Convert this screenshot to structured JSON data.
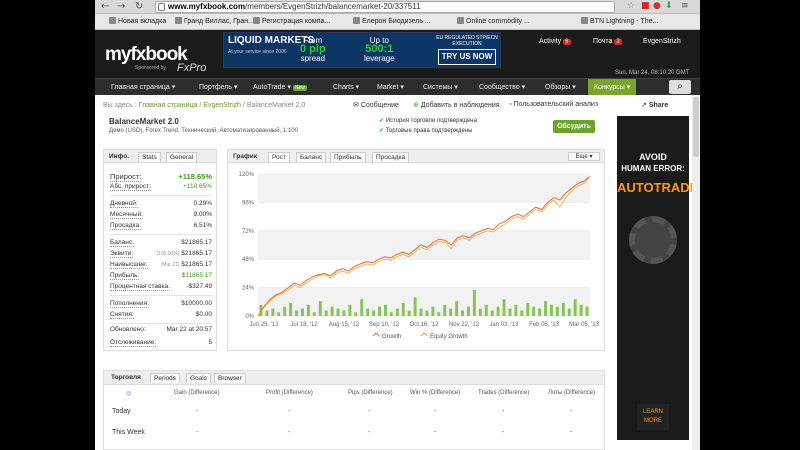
{
  "browser": {
    "url_domain": "www.myfxbook.com",
    "url_path": "/members/EvgenStrizh/balancemarket-20/337511",
    "bookmarks": [
      "Новая вкладка",
      "Гранд Виллас, Гран...",
      "Регистрация компа...",
      "Елерон Биодизель ...",
      "Online commodity ...",
      "BTN Lightning - The..."
    ]
  },
  "header": {
    "logo": "myfxbook",
    "sponsored": "Sponsored by",
    "sponsor_name": "FxPro",
    "banner": {
      "brand": "LIQUID MARKETS",
      "brand_sub": "At your service since 2006",
      "from_label": "From",
      "from_value": "0 pip",
      "from_sub": "spread",
      "upto_label": "Up to",
      "upto_value": "500:1",
      "upto_sub": "leverage",
      "reg": "EU REGULATED STP/ECN EXECUTION",
      "cta": "TRY US NOW"
    },
    "activity_label": "Activity",
    "activity_count": "6",
    "mail_label": "Почта",
    "mail_count": "2",
    "user": "EvgenStrizh",
    "datetime": "Sun, Mar 24, 08:10:20 GMT"
  },
  "menu": {
    "items": [
      "Главная страница ▾",
      "Портфель ▾",
      "AutoTrade ▾",
      "Charts ▾",
      "Market ▾",
      "Системы ▾",
      "Сообщество ▾",
      "Обзоры ▾",
      "Конкурсы ▾"
    ],
    "new_tag": "New"
  },
  "breadcrumb": {
    "prefix": "Вы здесь :",
    "home": "Главная страница",
    "user": "EvgenStrizh",
    "current": "/ BalanceMarket 2.0"
  },
  "actions": {
    "message": "Сообщение",
    "watch": "Добавить в наблюдения",
    "analysis": "Пользовательский анализ",
    "share": "Share"
  },
  "account": {
    "name": "BalanceMarket 2.0",
    "desc": "Демо (USD), Forex Trend, Технический, Автоматизированный, 1:100",
    "verif1": "История торговли подтверждена",
    "verif2": "Торговые права подтверждены",
    "discuss": "Обсудить"
  },
  "info_panel": {
    "tabs": [
      "Инфо.",
      "Stats",
      "General"
    ],
    "gain_label": "Прирост:",
    "gain": "+118.65%",
    "abs_label": "Абс. прирост:",
    "abs": "+118.65%",
    "daily_label": "Дневной:",
    "daily": "0.29%",
    "monthly_label": "Месячный:",
    "monthly": "9.00%",
    "dd_label": "Просадка:",
    "dd": "6.51%",
    "balance_label": "Баланс:",
    "balance": "$21865.17",
    "equity_label": "Эквити:",
    "equity_note": "(100.00%)",
    "equity": "$21865.17",
    "highest_label": "Наивысшее:",
    "highest_note": "(Mar 21)",
    "highest": "$21865.17",
    "profit_label": "Прибыль:",
    "profit": "$11865.17",
    "interest_label": "Процентная ставка:",
    "interest": "-$327.49",
    "deposits_label": "Пополнения:",
    "deposits": "$10000.00",
    "withdrawals_label": "Снятия:",
    "withdrawals": "$0.00",
    "updated_label": "Обновлено:",
    "updated": "Mar 22 at 20:57",
    "tracking_label": "Отслеживание:",
    "tracking": "5"
  },
  "chart_panel": {
    "tabs": [
      "График",
      "Рост",
      "Баланс",
      "Прибыль",
      "Просадка"
    ],
    "more": "Еще"
  },
  "chart_data": {
    "type": "line",
    "x_ticks": [
      "Jun 25, '12",
      "Jul 18, '12",
      "Aug 15, '12",
      "Sep 10, '12",
      "Oct 16, '12",
      "Nov 22, '12",
      "Jan 03, '13",
      "Feb 06, '13",
      "Mar 05, '13"
    ],
    "y_ticks": [
      "0%",
      "24%",
      "48%",
      "72%",
      "96%",
      "120%"
    ],
    "ylim": [
      0,
      120
    ],
    "series": [
      {
        "name": "Growth",
        "color": "#e8683a",
        "values": [
          0,
          8,
          14,
          18,
          20,
          24,
          28,
          26,
          30,
          33,
          35,
          36,
          34,
          38,
          40,
          38,
          42,
          44,
          46,
          45,
          48,
          50,
          49,
          52,
          54,
          52,
          56,
          60,
          58,
          62,
          65,
          64,
          60,
          66,
          68,
          66,
          70,
          72,
          74,
          73,
          78,
          80,
          84,
          86,
          84,
          88,
          92,
          90,
          96,
          100,
          98,
          104,
          108,
          112,
          114,
          118
        ]
      },
      {
        "name": "Equity Growth",
        "color": "#e8a830",
        "values": [
          0,
          7,
          13,
          17,
          19,
          22,
          26,
          24,
          28,
          31,
          34,
          35,
          32,
          36,
          38,
          36,
          40,
          42,
          44,
          43,
          46,
          48,
          47,
          50,
          52,
          50,
          54,
          58,
          56,
          60,
          63,
          62,
          57,
          64,
          66,
          64,
          68,
          70,
          72,
          71,
          75,
          78,
          82,
          84,
          82,
          86,
          90,
          88,
          94,
          98,
          92,
          100,
          106,
          110,
          112,
          118
        ]
      }
    ],
    "bars": [
      6,
      3,
      4,
      2,
      5,
      7,
      3,
      4,
      6,
      2,
      8,
      3,
      5,
      4,
      3,
      6,
      2,
      9,
      4,
      3,
      5,
      6,
      2,
      4,
      7,
      3,
      10,
      4,
      3,
      5,
      2,
      6,
      4,
      8,
      3,
      5,
      14,
      4,
      6,
      3,
      5,
      9,
      4,
      6,
      3,
      7,
      5,
      4,
      8,
      6,
      5,
      7,
      4,
      9,
      6,
      5
    ]
  },
  "trading_panel": {
    "tabs": [
      "Торговля",
      "Periods",
      "Goals",
      "Browser"
    ],
    "columns": [
      "Gain (Difference)",
      "Profit (Difference)",
      "Pips (Difference)",
      "Win % (Difference)",
      "Trades (Difference)",
      "Лоты (Difference)"
    ],
    "rows": [
      {
        "label": "Today",
        "values": [
          "-",
          "-",
          "-",
          "-",
          "-",
          "-"
        ]
      },
      {
        "label": "This Week",
        "values": [
          "-",
          "-",
          "-",
          "-",
          "-",
          "-"
        ]
      }
    ]
  },
  "ad": {
    "line1": "AVOID",
    "line2": "HUMAN ERROR:",
    "line3": "AUTOTRADE",
    "button": "LEARN MORE"
  }
}
